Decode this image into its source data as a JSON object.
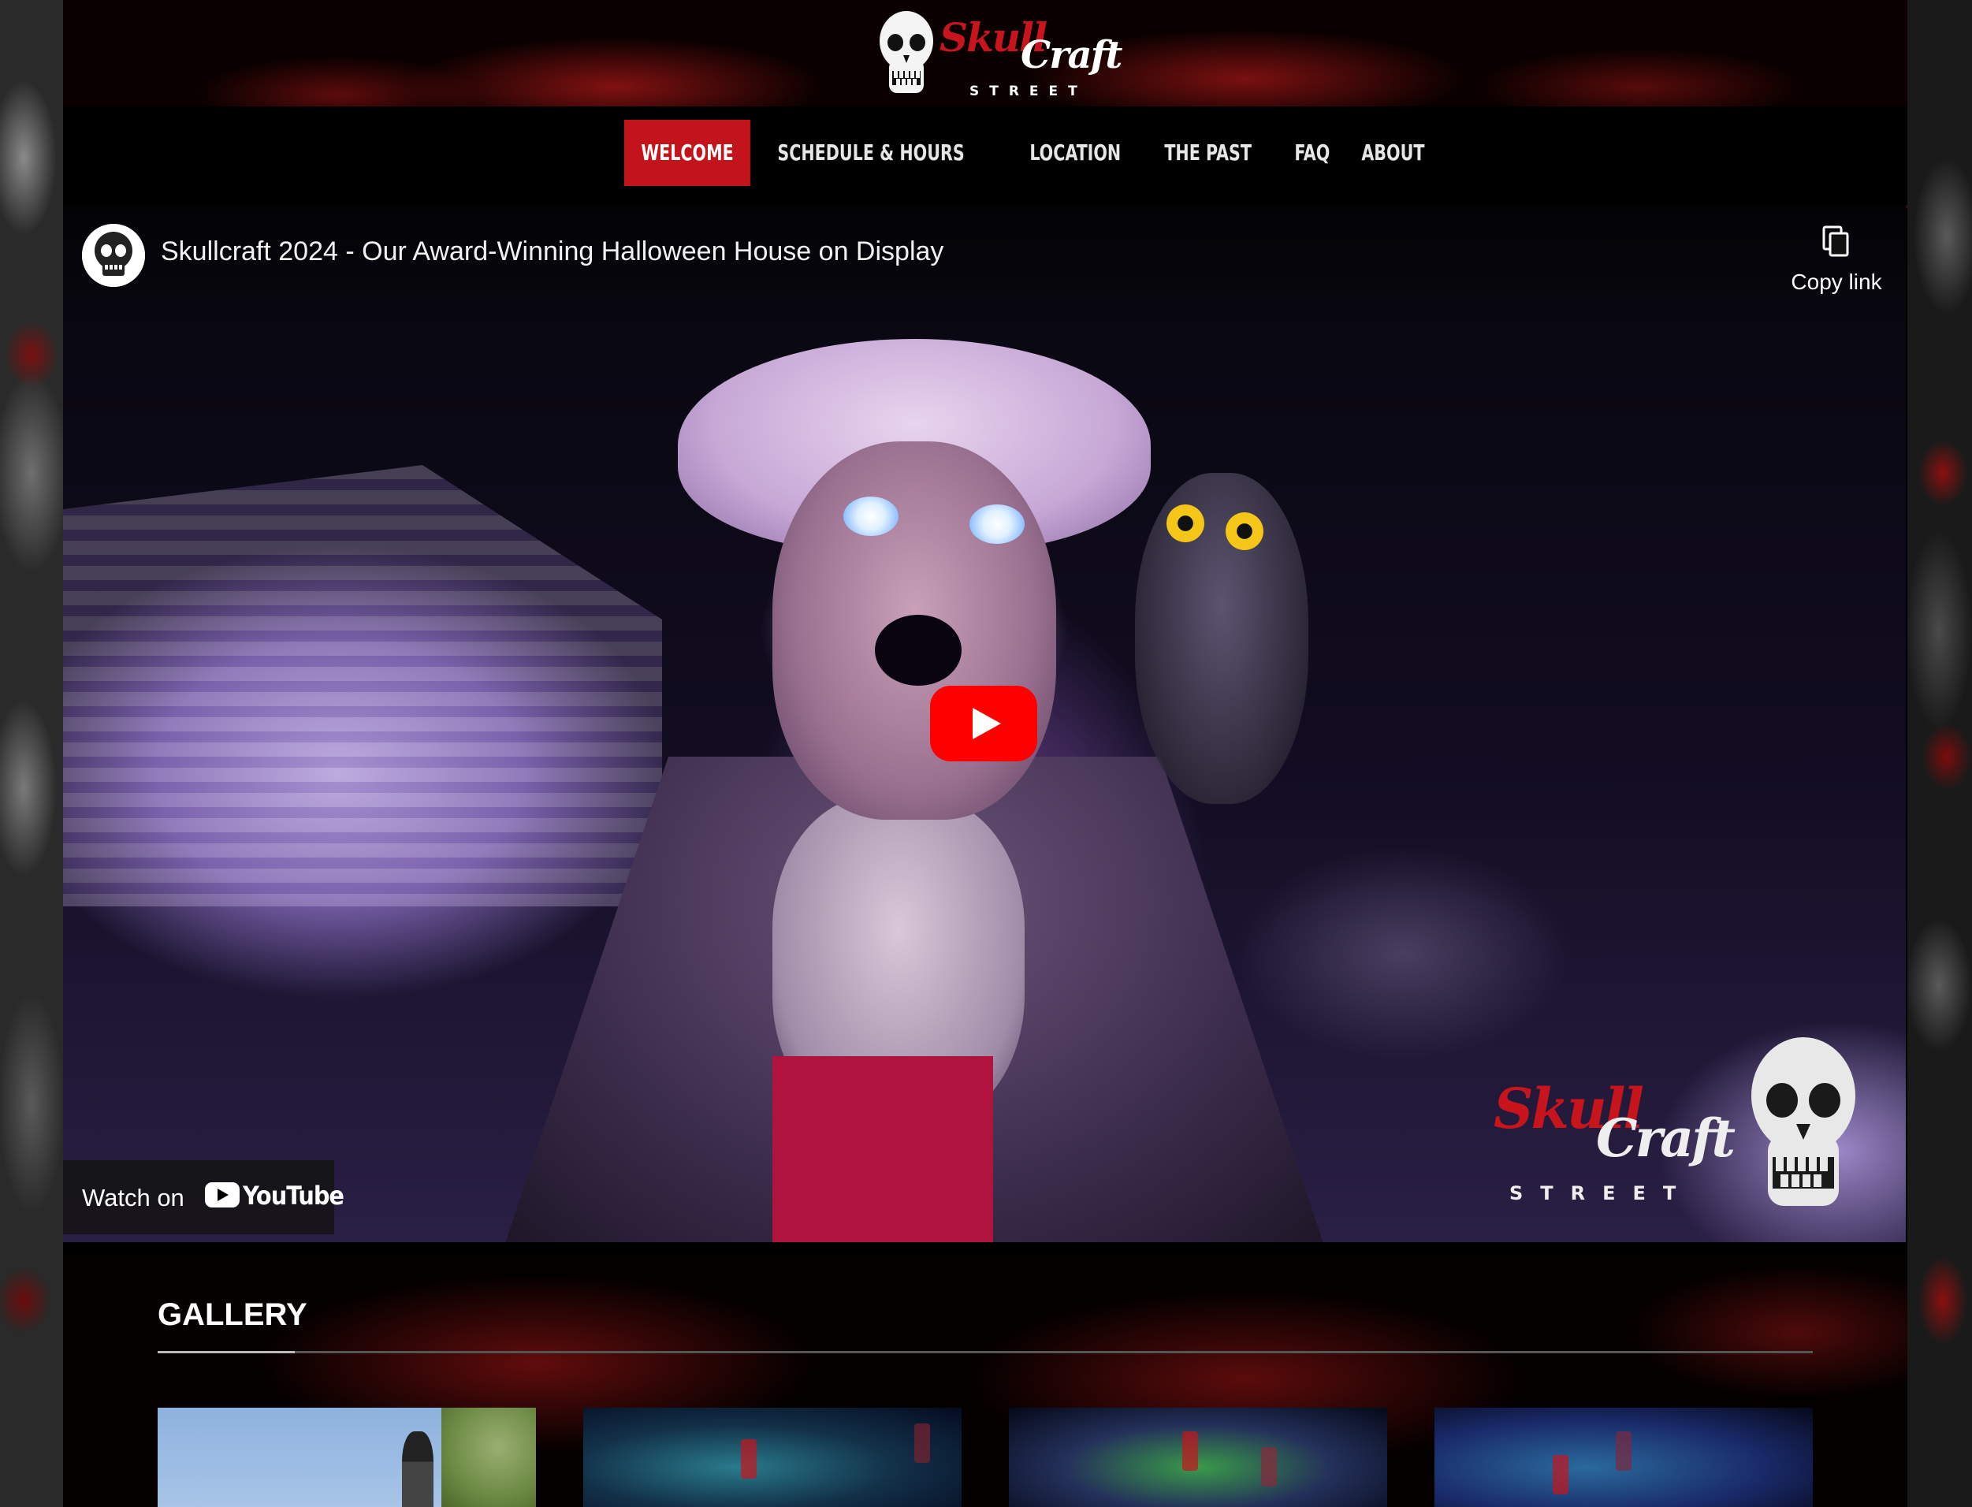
{
  "brand": {
    "word1": "Skull",
    "word2": "Craft",
    "street": "STREET",
    "accent_color": "#c4141b"
  },
  "nav": {
    "items": [
      {
        "label": "WELCOME",
        "active": true
      },
      {
        "label": "SCHEDULE & HOURS",
        "active": false
      },
      {
        "label": "LOCATION",
        "active": false
      },
      {
        "label": "THE PAST",
        "active": false
      },
      {
        "label": "FAQ",
        "active": false
      },
      {
        "label": "ABOUT",
        "active": false
      }
    ]
  },
  "video": {
    "title": "Skullcraft 2024 - Our Award-Winning Halloween House on Display",
    "copy_link_label": "Copy link",
    "watch_on_label": "Watch on",
    "youtube_word": "YouTube",
    "play_button_color": "#ff0000",
    "watermark": {
      "word1": "Skull",
      "word2": "Craft",
      "street": "STREET"
    }
  },
  "gallery": {
    "title": "GALLERY"
  }
}
